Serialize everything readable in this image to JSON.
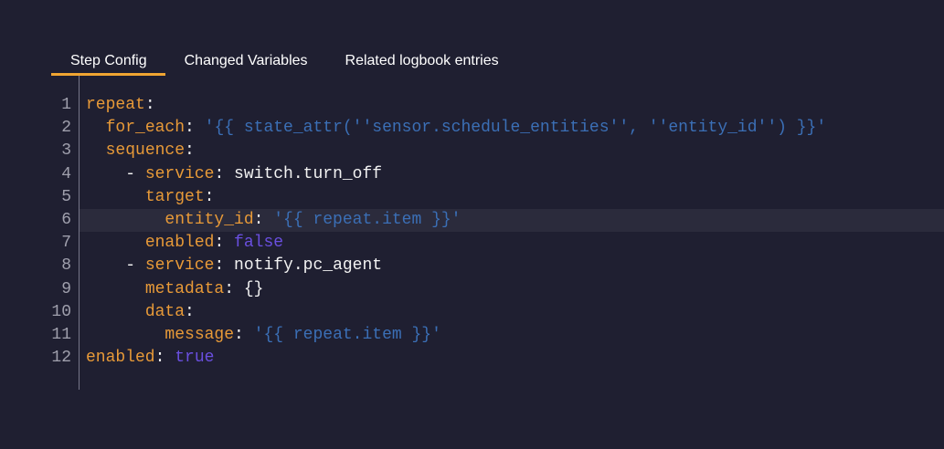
{
  "tabs": [
    {
      "label": "Step Config",
      "active": true
    },
    {
      "label": "Changed Variables",
      "active": false
    },
    {
      "label": "Related logbook entries",
      "active": false
    }
  ],
  "colors": {
    "key": "#e89a38",
    "string": "#3b6fb6",
    "boolean": "#6a4fe0",
    "accent": "#f0a532"
  },
  "code_lines": [
    {
      "n": "1",
      "indent": "",
      "key": "repeat",
      "sep": ":",
      "value": "",
      "type": ""
    },
    {
      "n": "2",
      "indent": "  ",
      "key": "for_each",
      "sep": ": ",
      "value": "'{{ state_attr(''sensor.schedule_entities'', ''entity_id'') }}'",
      "type": "s"
    },
    {
      "n": "3",
      "indent": "  ",
      "key": "sequence",
      "sep": ":",
      "value": "",
      "type": ""
    },
    {
      "n": "4",
      "indent": "    - ",
      "key": "service",
      "sep": ": ",
      "value": "switch.turn_off",
      "type": "p"
    },
    {
      "n": "5",
      "indent": "      ",
      "key": "target",
      "sep": ":",
      "value": "",
      "type": ""
    },
    {
      "n": "6",
      "indent": "        ",
      "key": "entity_id",
      "sep": ": ",
      "value": "'{{ repeat.item }}'",
      "type": "s"
    },
    {
      "n": "7",
      "indent": "      ",
      "key": "enabled",
      "sep": ": ",
      "value": "false",
      "type": "b"
    },
    {
      "n": "8",
      "indent": "    - ",
      "key": "service",
      "sep": ": ",
      "value": "notify.pc_agent",
      "type": "p"
    },
    {
      "n": "9",
      "indent": "      ",
      "key": "metadata",
      "sep": ": ",
      "value": "{}",
      "type": "p"
    },
    {
      "n": "10",
      "indent": "      ",
      "key": "data",
      "sep": ":",
      "value": "",
      "type": ""
    },
    {
      "n": "11",
      "indent": "        ",
      "key": "message",
      "sep": ": ",
      "value": "'{{ repeat.item }}'",
      "type": "s"
    },
    {
      "n": "12",
      "indent": "",
      "key": "enabled",
      "sep": ": ",
      "value": "true",
      "type": "b"
    }
  ],
  "highlighted_line": "6"
}
